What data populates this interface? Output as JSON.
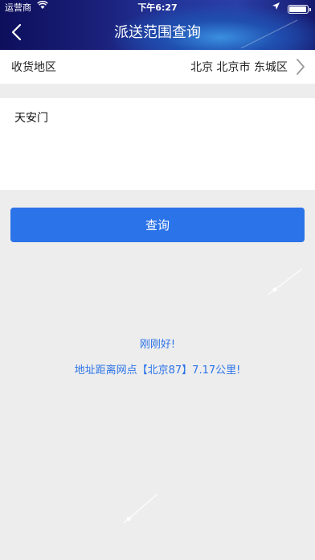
{
  "status_bar": {
    "carrier": "运营商",
    "time": "下午6:27"
  },
  "nav": {
    "title": "派送范围查询"
  },
  "region_row": {
    "label": "收货地区",
    "value": "北京 北京市 东城区"
  },
  "address": {
    "value": "天安门"
  },
  "query_button": {
    "label": "查询"
  },
  "result": {
    "line1": "刚刚好!",
    "line2": "地址距离网点【北京87】7.17公里!"
  },
  "colors": {
    "accent": "#2b73e8",
    "background": "#ededed"
  }
}
